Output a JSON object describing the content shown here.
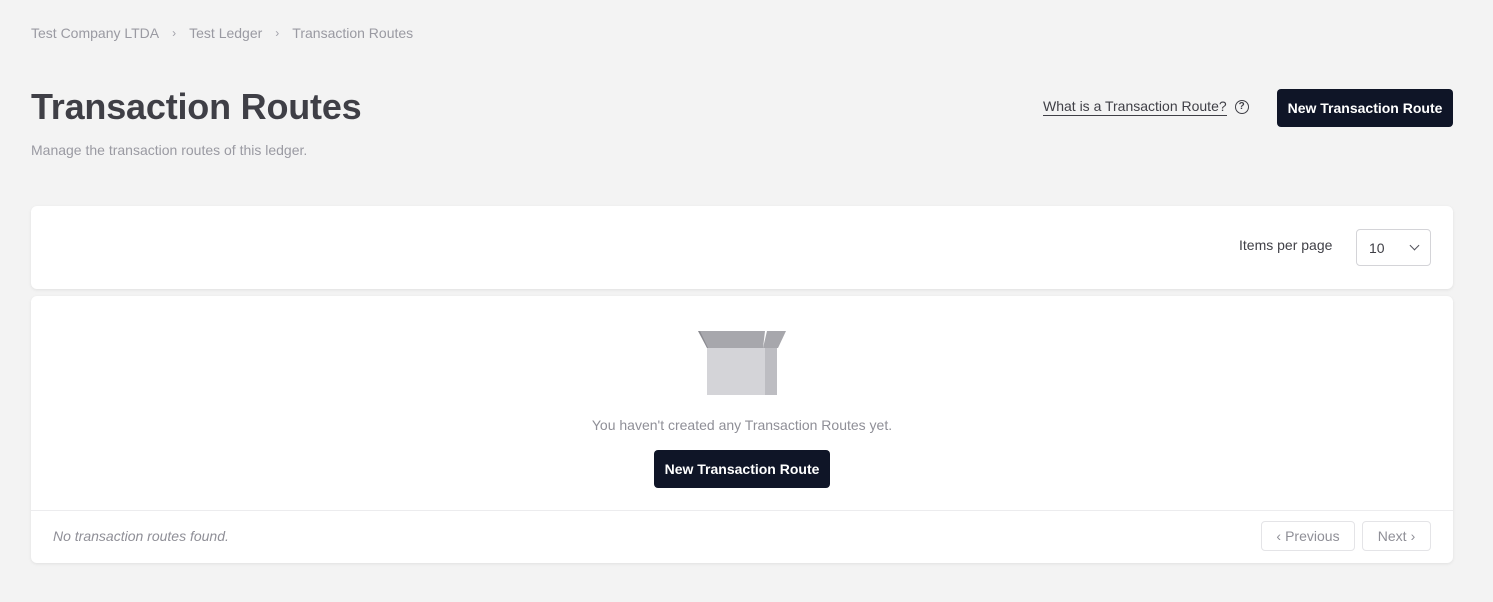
{
  "breadcrumb": {
    "items": [
      "Test Company LTDA",
      "Test Ledger",
      "Transaction Routes"
    ],
    "separator_icon": "chevron-right-icon"
  },
  "header": {
    "title": "Transaction Routes",
    "subtitle": "Manage the transaction routes of this ledger.",
    "help_link_label": "What is a Transaction Route?",
    "help_icon": "question-circle-icon",
    "new_button_label": "New Transaction Route"
  },
  "toolbar": {
    "items_per_page_label": "Items per page",
    "items_per_page_value": "10",
    "select_icon": "chevron-down-icon"
  },
  "empty_state": {
    "icon": "empty-box-icon",
    "message": "You haven't created any Transaction Routes yet.",
    "button_label": "New Transaction Route"
  },
  "footer": {
    "status": "No transaction routes found.",
    "previous_label": "Previous",
    "next_label": "Next"
  },
  "colors": {
    "background": "#f3f3f3",
    "primary_button": "#0f1527",
    "card": "#ffffff",
    "muted_text": "#9a9aa2"
  }
}
